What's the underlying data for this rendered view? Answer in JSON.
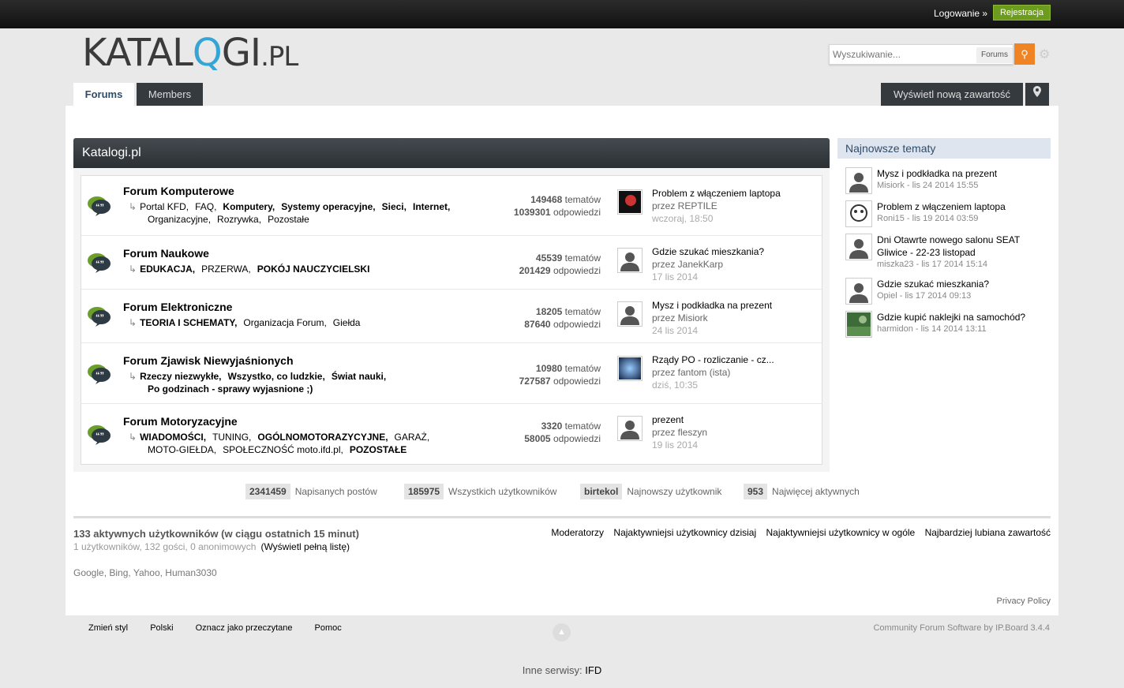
{
  "topbar": {
    "login_label": "Logowanie »",
    "register_label": "Rejestracja"
  },
  "logo": {
    "main": "KATAL",
    "q": "Q",
    "rest": "GI",
    "suffix": ".PL"
  },
  "search": {
    "placeholder": "Wyszukiwanie...",
    "scope": "Forums",
    "button_icon": "search-icon",
    "settings_icon": "gear-icon"
  },
  "tabs": [
    {
      "label": "Forums"
    },
    {
      "label": "Members"
    }
  ],
  "actions": {
    "new_content": "Wyświetl nową zawartość",
    "pin_icon": "map-marker-icon"
  },
  "category": {
    "title": "Katalogi.pl"
  },
  "forums": [
    {
      "name": "Forum Komputerowe",
      "subs_line1": [
        "Portal KFD,",
        "FAQ,",
        "Komputery,",
        "Systemy operacyjne,",
        "Sieci,",
        "Internet,"
      ],
      "subs_line2": [
        "Organizacyjne,",
        "Rozrywka,",
        "Pozostałe"
      ],
      "topics": "149468",
      "replies": "1039301",
      "last_title": "Problem z włączeniem laptopa",
      "last_by": "przez REPTILE",
      "last_date": "wczoraj, 18:50"
    },
    {
      "name": "Forum Naukowe",
      "subs_line1": [
        "EDUKACJA,",
        "PRZERWA,",
        "POKÓJ NAUCZYCIELSKI"
      ],
      "subs_line2": [],
      "topics": "45539",
      "replies": "201429",
      "last_title": "Gdzie szukać mieszkania?",
      "last_by": "przez JanekKarp",
      "last_date": "17 lis 2014"
    },
    {
      "name": "Forum Elektroniczne",
      "subs_line1": [
        "TEORIA I SCHEMATY,",
        "Organizacja Forum,",
        "Giełda"
      ],
      "subs_line2": [],
      "topics": "18205",
      "replies": "87640",
      "last_title": "Mysz i podkładka na prezent",
      "last_by": "przez Misiork",
      "last_date": "24 lis 2014"
    },
    {
      "name": "Forum Zjawisk Niewyjaśnionych",
      "subs_line1": [
        "Rzeczy niezwykłe,",
        "Wszystko, co ludzkie,",
        "Świat nauki,"
      ],
      "subs_line2": [
        "Po godzinach - sprawy wyjasnione ;)"
      ],
      "topics": "10980",
      "replies": "727587",
      "last_title": "Rządy PO - rozliczanie - cz...",
      "last_by": "przez fantom (ista)",
      "last_date": "dziś, 10:35"
    },
    {
      "name": "Forum Motoryzacyjne",
      "subs_line1": [
        "WIADOMOŚCI,",
        "TUNING,",
        "OGÓLNOMOTORAZYCYJNE,",
        "GARAŻ,"
      ],
      "subs_line2": [
        "MOTO-GIEŁDA,",
        "SPOŁECZNOŚĆ moto.ifd.pl,",
        "POZOSTAŁE"
      ],
      "topics": "3320",
      "replies": "58005",
      "last_title": "prezent",
      "last_by": "przez fleszyn",
      "last_date": "19 lis 2014"
    }
  ],
  "labels": {
    "topics": "tematów",
    "replies": "odpowiedzi"
  },
  "sidebar": {
    "title": "Najnowsze tematy",
    "items": [
      {
        "title": "Mysz i podkładka na prezent",
        "meta": "Misiork - lis 24 2014 15:55"
      },
      {
        "title": "Problem z włączeniem laptopa",
        "meta": "Roni15 - lis 19 2014 03:59"
      },
      {
        "title": "Dni Otawrte nowego salonu SEAT Gliwice - 22-23 listopad",
        "meta": "miszka23 - lis 17 2014 15:14"
      },
      {
        "title": "Gdzie szukać mieszkania?",
        "meta": "Opiel - lis 17 2014 09:13"
      },
      {
        "title": "Gdzie kupić naklejki na samochód?",
        "meta": "harmidon - lis 14 2014 13:11"
      }
    ]
  },
  "board_stats": [
    {
      "value": "2341459",
      "label": "Napisanych postów"
    },
    {
      "value": "185975",
      "label": "Wszystkich użytkowników"
    },
    {
      "value": "birtekol",
      "label": "Najnowszy użytkownik"
    },
    {
      "value": "953",
      "label": "Najwięcej aktywnych"
    }
  ],
  "active": {
    "title": "133 aktywnych użytkowników (w ciągu ostatnich 15 minut)",
    "sub": "1 użytkowników, 132 gości, 0 anonimowych",
    "full_list": "(Wyświetl pełną listę)",
    "links": [
      "Moderatorzy",
      "Najaktywniejsi użytkownicy dzisiaj",
      "Najaktywniejsi użytkownicy w ogóle",
      "Najbardziej lubiana zawartość"
    ],
    "bots": "Google, Bing, Yahoo, Human3030"
  },
  "footer": {
    "privacy": "Privacy Policy",
    "links": [
      "Zmień styl",
      "Polski",
      "Oznacz jako przeczytane",
      "Pomoc"
    ],
    "powered": "Community Forum Software by IP.Board 3.4.4",
    "other_label": "Inne serwisy:",
    "other_link": "IFD"
  }
}
